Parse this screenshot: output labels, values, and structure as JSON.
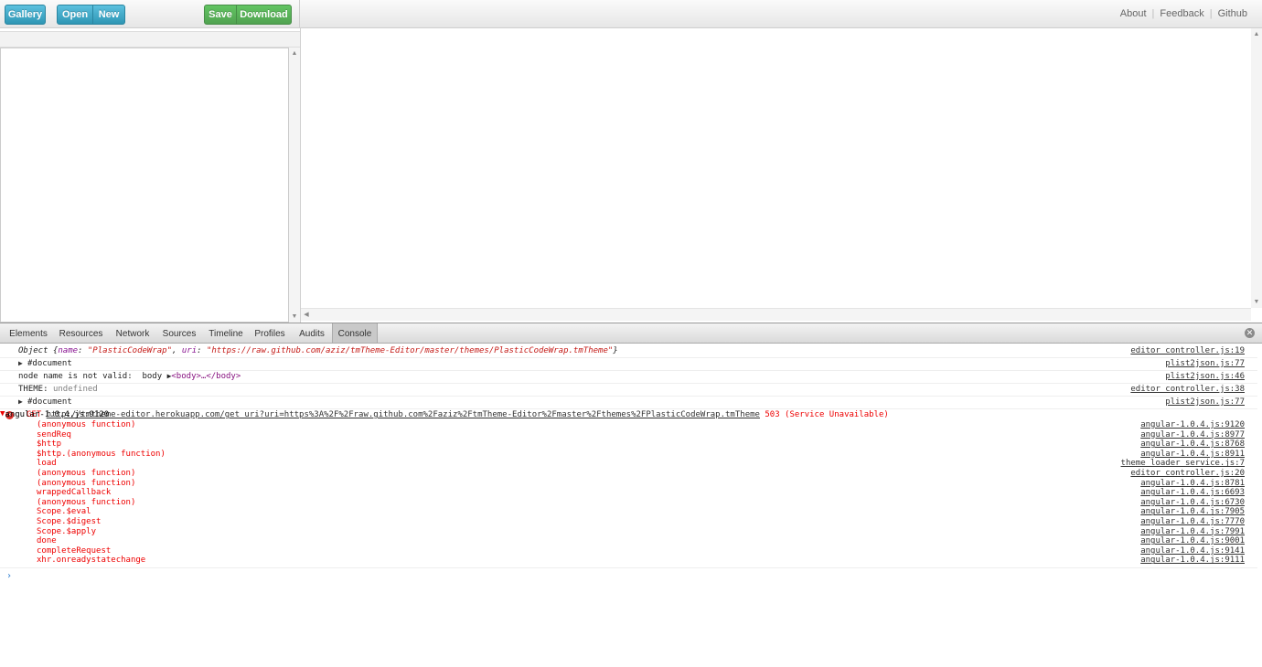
{
  "toolbar": {
    "gallery_label": "Gallery",
    "open_label": "Open",
    "new_label": "New",
    "save_label": "Save",
    "download_label": "Download",
    "links": [
      "About",
      "Feedback",
      "Github"
    ]
  },
  "devtools": {
    "tabs": [
      "Elements",
      "Resources",
      "Network",
      "Sources",
      "Timeline",
      "Profiles",
      "Audits",
      "Console"
    ],
    "active_tab": "Console",
    "console": {
      "log1": {
        "prefix": "Object {",
        "k1": "name",
        "v1": "\"PlasticCodeWrap\"",
        "k2": "uri",
        "v2": "\"https://raw.github.com/aziz/tmTheme-Editor/master/themes/PlasticCodeWrap.tmTheme\"",
        "suffix": "}",
        "source": "editor_controller.js:19"
      },
      "log2": {
        "text": "#document",
        "source": "plist2json.js:77"
      },
      "log3": {
        "text": "node name is not valid:  body ",
        "tag": "<body>…</body>",
        "source": "plist2json.js:46"
      },
      "log4": {
        "label": "THEME: ",
        "value": "undefined",
        "source": "editor_controller.js:38"
      },
      "log5": {
        "text": "#document",
        "source": "plist2json.js:77"
      },
      "error": {
        "method": "GET ",
        "url": "http://tmtheme-editor.herokuapp.com/get_uri?uri=https%3A%2F%2Fraw.github.com%2Faziz%2FtmTheme-Editor%2Fmaster%2Fthemes%2FPlasticCodeWrap.tmTheme",
        "status": " 503 (Service Unavailable)",
        "source": "angular-1.0.4.js:9120",
        "stack": [
          {
            "fn": "(anonymous function)",
            "src": "angular-1.0.4.js:9120"
          },
          {
            "fn": "sendReq",
            "src": "angular-1.0.4.js:8977"
          },
          {
            "fn": "$http",
            "src": "angular-1.0.4.js:8768"
          },
          {
            "fn": "$http.(anonymous function)",
            "src": "angular-1.0.4.js:8911"
          },
          {
            "fn": "load",
            "src": "theme_loader_service.js:7"
          },
          {
            "fn": "(anonymous function)",
            "src": "editor_controller.js:20"
          },
          {
            "fn": "(anonymous function)",
            "src": "angular-1.0.4.js:8781"
          },
          {
            "fn": "wrappedCallback",
            "src": "angular-1.0.4.js:6693"
          },
          {
            "fn": "(anonymous function)",
            "src": "angular-1.0.4.js:6730"
          },
          {
            "fn": "Scope.$eval",
            "src": "angular-1.0.4.js:7905"
          },
          {
            "fn": "Scope.$digest",
            "src": "angular-1.0.4.js:7770"
          },
          {
            "fn": "Scope.$apply",
            "src": "angular-1.0.4.js:7991"
          },
          {
            "fn": "done",
            "src": "angular-1.0.4.js:9001"
          },
          {
            "fn": "completeRequest",
            "src": "angular-1.0.4.js:9141"
          },
          {
            "fn": "xhr.onreadystatechange",
            "src": "angular-1.0.4.js:9111"
          }
        ]
      },
      "prompt": "›"
    }
  },
  "icons": {
    "triangle_right": "▶",
    "triangle_down": "▼",
    "error": "✕",
    "close": "✕",
    "scroll_up": "▲",
    "scroll_down": "▼",
    "scroll_left": "◀"
  }
}
